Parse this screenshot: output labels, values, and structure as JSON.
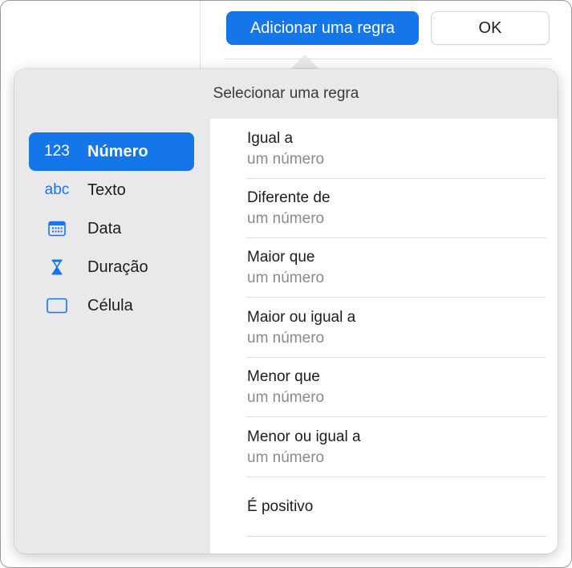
{
  "toolbar": {
    "add_rule_label": "Adicionar uma regra",
    "ok_label": "OK"
  },
  "popover": {
    "title": "Selecionar uma regra"
  },
  "sidebar": {
    "items": [
      {
        "icon": "123",
        "icon_name": "number-icon",
        "label": "Número",
        "selected": true
      },
      {
        "icon": "abc",
        "icon_name": "text-icon",
        "label": "Texto",
        "selected": false
      },
      {
        "icon": "",
        "icon_name": "calendar-icon",
        "label": "Data",
        "selected": false
      },
      {
        "icon": "",
        "icon_name": "hourglass-icon",
        "label": "Duração",
        "selected": false
      },
      {
        "icon": "",
        "icon_name": "cell-icon",
        "label": "Célula",
        "selected": false
      }
    ]
  },
  "rules": [
    {
      "title": "Igual a",
      "subtitle": "um número"
    },
    {
      "title": "Diferente de",
      "subtitle": "um número"
    },
    {
      "title": "Maior que",
      "subtitle": "um número"
    },
    {
      "title": "Maior ou igual a",
      "subtitle": "um número"
    },
    {
      "title": "Menor que",
      "subtitle": "um número"
    },
    {
      "title": "Menor ou igual a",
      "subtitle": "um número"
    },
    {
      "title": "É positivo",
      "subtitle": ""
    }
  ],
  "colors": {
    "accent": "#1476e8",
    "popover_bg": "#e9e9eb",
    "subtitle": "#8a8a8e"
  }
}
